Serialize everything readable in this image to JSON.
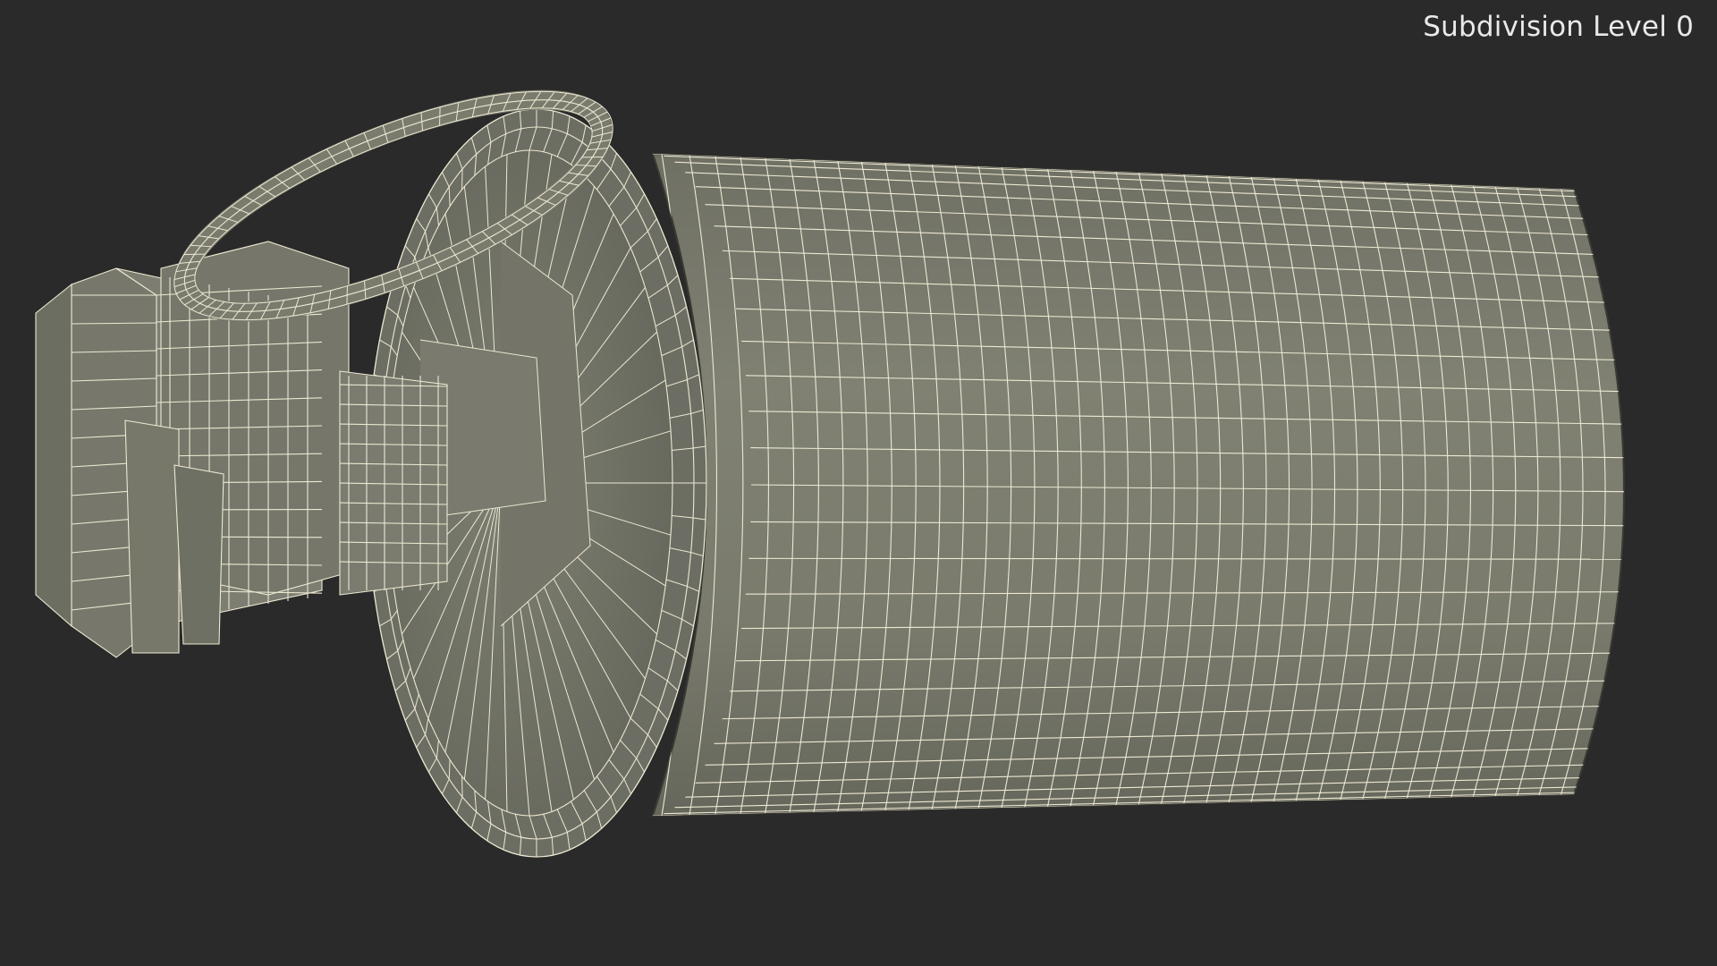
{
  "viewport": {
    "background_color": "#2a2a2a",
    "subdivision_label": "Subdivision Level 0",
    "label_color": "#e9e9e9"
  },
  "model": {
    "subject": "smoke grenade wireframe mesh",
    "surface_color": "#7c7d6f",
    "wire_color": "#ece8d2"
  }
}
